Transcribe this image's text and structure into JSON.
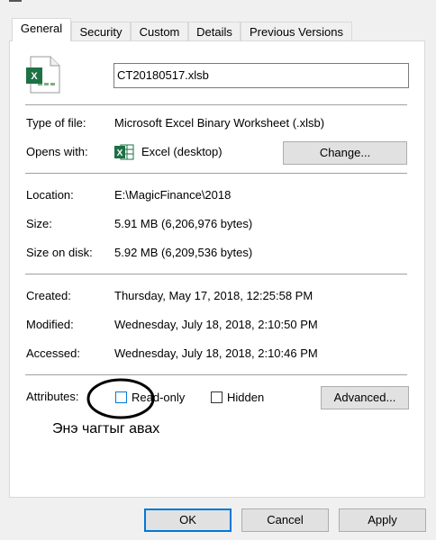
{
  "tabs": [
    "General",
    "Security",
    "Custom",
    "Details",
    "Previous Versions"
  ],
  "file": {
    "name": "CT20180517.xlsb",
    "icon": "excel-file-icon"
  },
  "type_of_file": {
    "label": "Type of file:",
    "value": "Microsoft Excel Binary Worksheet (.xlsb)"
  },
  "opens_with": {
    "label": "Opens with:",
    "app": "Excel (desktop)",
    "change_label": "Change...",
    "icon": "excel-app-icon"
  },
  "location": {
    "label": "Location:",
    "value": "E:\\MagicFinance\\2018"
  },
  "size": {
    "label": "Size:",
    "value": "5.91 MB (6,206,976 bytes)"
  },
  "size_on_disk": {
    "label": "Size on disk:",
    "value": "5.92 MB (6,209,536 bytes)"
  },
  "created": {
    "label": "Created:",
    "value": "Thursday, May 17, 2018, 12:25:58 PM"
  },
  "modified": {
    "label": "Modified:",
    "value": "Wednesday, July 18, 2018, 2:10:50 PM"
  },
  "accessed": {
    "label": "Accessed:",
    "value": "Wednesday, July 18, 2018, 2:10:46 PM"
  },
  "attributes": {
    "label": "Attributes:",
    "read_only_label": "Read-only",
    "read_only_checked": false,
    "hidden_label": "Hidden",
    "hidden_checked": false,
    "advanced_label": "Advanced..."
  },
  "annotation": {
    "text": "Энэ чагтыг авах"
  },
  "buttons": {
    "ok": "OK",
    "cancel": "Cancel",
    "apply": "Apply"
  },
  "colors": {
    "excel_green": "#1e7145",
    "focus_blue": "#0078d7"
  }
}
